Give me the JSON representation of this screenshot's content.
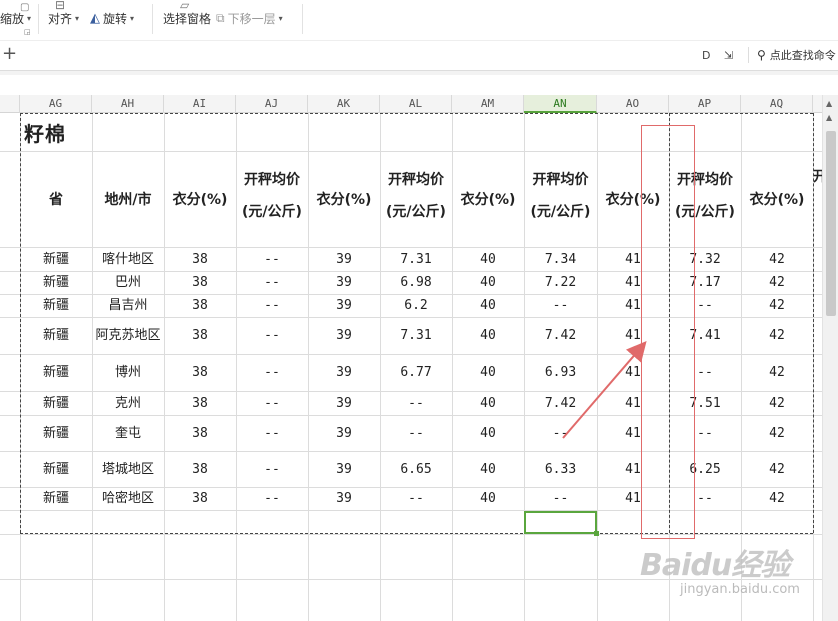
{
  "toolbar": {
    "scale_label": "缩放",
    "align_label": "对齐",
    "rotate_label": "旋转",
    "selection_pane_label": "选择窗格",
    "move_down_label": "下移一层"
  },
  "bar2": {
    "add_tab": "+",
    "search_placeholder": "点此查找命令"
  },
  "columns": [
    {
      "id": "ag",
      "label": "AG"
    },
    {
      "id": "ah",
      "label": "AH"
    },
    {
      "id": "ai",
      "label": "AI"
    },
    {
      "id": "aj",
      "label": "AJ"
    },
    {
      "id": "ak",
      "label": "AK"
    },
    {
      "id": "al",
      "label": "AL"
    },
    {
      "id": "am",
      "label": "AM"
    },
    {
      "id": "an",
      "label": "AN"
    },
    {
      "id": "ao",
      "label": "AO"
    },
    {
      "id": "ap",
      "label": "AP"
    },
    {
      "id": "aq",
      "label": "AQ"
    }
  ],
  "sheet": {
    "title": "籽棉",
    "headers": {
      "province": "省",
      "prefecture": "地州/市",
      "clothing_pct": "衣分(%)",
      "price_line1": "开秤均价",
      "price_line2": "(元/公斤)",
      "overflow": "开"
    },
    "rows": [
      [
        "新疆",
        "喀什地区",
        "38",
        "--",
        "39",
        "7.31",
        "40",
        "7.34",
        "41",
        "7.32",
        "42"
      ],
      [
        "新疆",
        "巴州",
        "38",
        "--",
        "39",
        "6.98",
        "40",
        "7.22",
        "41",
        "7.17",
        "42"
      ],
      [
        "新疆",
        "昌吉州",
        "38",
        "--",
        "39",
        "6.2",
        "40",
        "--",
        "41",
        "--",
        "42"
      ],
      [
        "新疆",
        "阿克苏地区",
        "38",
        "--",
        "39",
        "7.31",
        "40",
        "7.42",
        "41",
        "7.41",
        "42"
      ],
      [
        "新疆",
        "博州",
        "38",
        "--",
        "39",
        "6.77",
        "40",
        "6.93",
        "41",
        "--",
        "42"
      ],
      [
        "新疆",
        "克州",
        "38",
        "--",
        "39",
        "--",
        "40",
        "7.42",
        "41",
        "7.51",
        "42"
      ],
      [
        "新疆",
        "奎屯",
        "38",
        "--",
        "39",
        "--",
        "40",
        "--",
        "41",
        "--",
        "42"
      ],
      [
        "新疆",
        "塔城地区",
        "38",
        "--",
        "39",
        "6.65",
        "40",
        "6.33",
        "41",
        "6.25",
        "42"
      ],
      [
        "新疆",
        "哈密地区",
        "38",
        "--",
        "39",
        "--",
        "40",
        "--",
        "41",
        "--",
        "42"
      ]
    ]
  },
  "watermark": {
    "logo": "Baidu经验",
    "sub": "jingyan.baidu.com"
  },
  "colors": {
    "selection": "#5aa63e",
    "annotation": "#e06a6a"
  }
}
